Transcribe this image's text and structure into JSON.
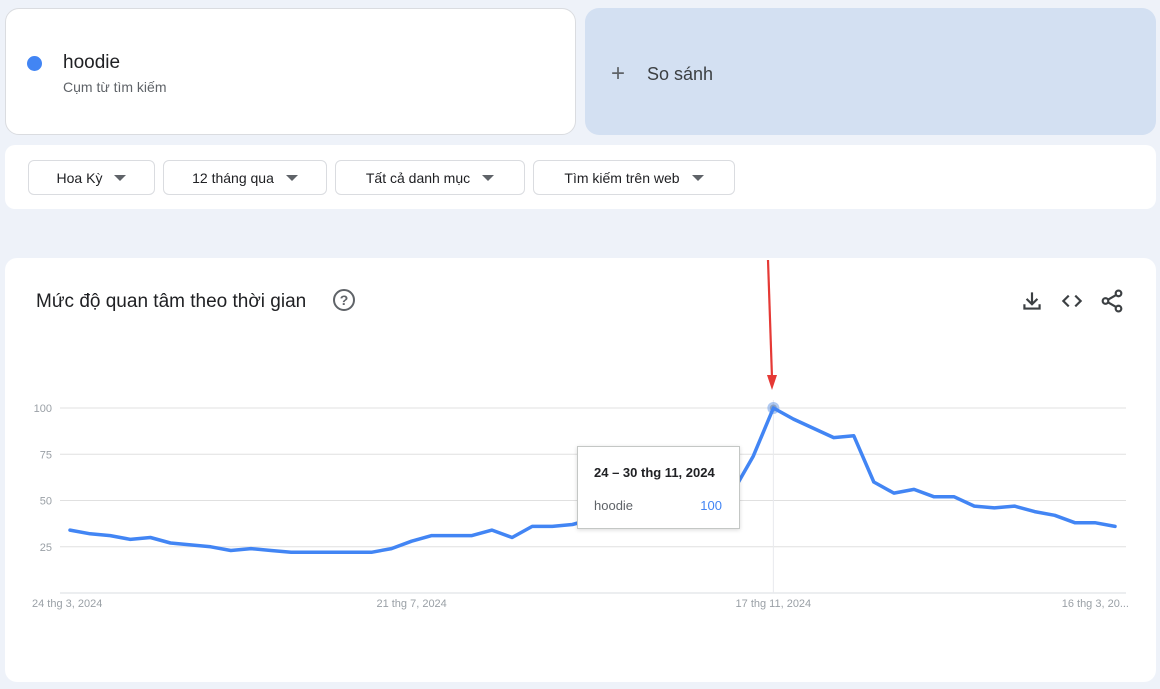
{
  "search_term": {
    "name": "hoodie",
    "subtitle": "Cụm từ tìm kiếm",
    "color": "#4285f4"
  },
  "compare": {
    "label": "So sánh",
    "icon": "plus-icon"
  },
  "filters": [
    {
      "label": "Hoa Kỳ"
    },
    {
      "label": "12 tháng qua"
    },
    {
      "label": "Tất cả danh mục"
    },
    {
      "label": "Tìm kiếm trên web"
    }
  ],
  "chart": {
    "title": "Mức độ quan tâm theo thời gian",
    "help_icon": "?",
    "actions": [
      "download-icon",
      "embed-code-icon",
      "share-icon"
    ]
  },
  "tooltip": {
    "date": "24 – 30 thg 11, 2024",
    "series": "hoodie",
    "value": "100"
  },
  "annotation": {
    "type": "red-arrow",
    "points_to": "peak",
    "color": "#e53935"
  },
  "chart_data": {
    "type": "line",
    "title": "Mức độ quan tâm theo thời gian",
    "xlabel": "",
    "ylabel": "",
    "ylim": [
      0,
      100
    ],
    "yticks": [
      25,
      50,
      75,
      100
    ],
    "x_tick_labels": [
      "24 thg 3, 2024",
      "21 thg 7, 2024",
      "17 thg 11, 2024",
      "16 thg 3, 20..."
    ],
    "x_tick_index": [
      0,
      17,
      35,
      52
    ],
    "grid": true,
    "highlight_index": 35,
    "series": [
      {
        "name": "hoodie",
        "color": "#4285f4",
        "values": [
          34,
          32,
          31,
          29,
          30,
          27,
          26,
          25,
          23,
          24,
          23,
          22,
          22,
          22,
          22,
          22,
          24,
          28,
          31,
          31,
          31,
          34,
          30,
          36,
          36,
          37,
          40,
          43,
          47,
          52,
          54,
          54,
          51,
          55,
          74,
          100,
          94,
          89,
          84,
          85,
          60,
          54,
          56,
          52,
          52,
          47,
          46,
          47,
          44,
          42,
          38,
          38,
          36
        ]
      }
    ]
  }
}
